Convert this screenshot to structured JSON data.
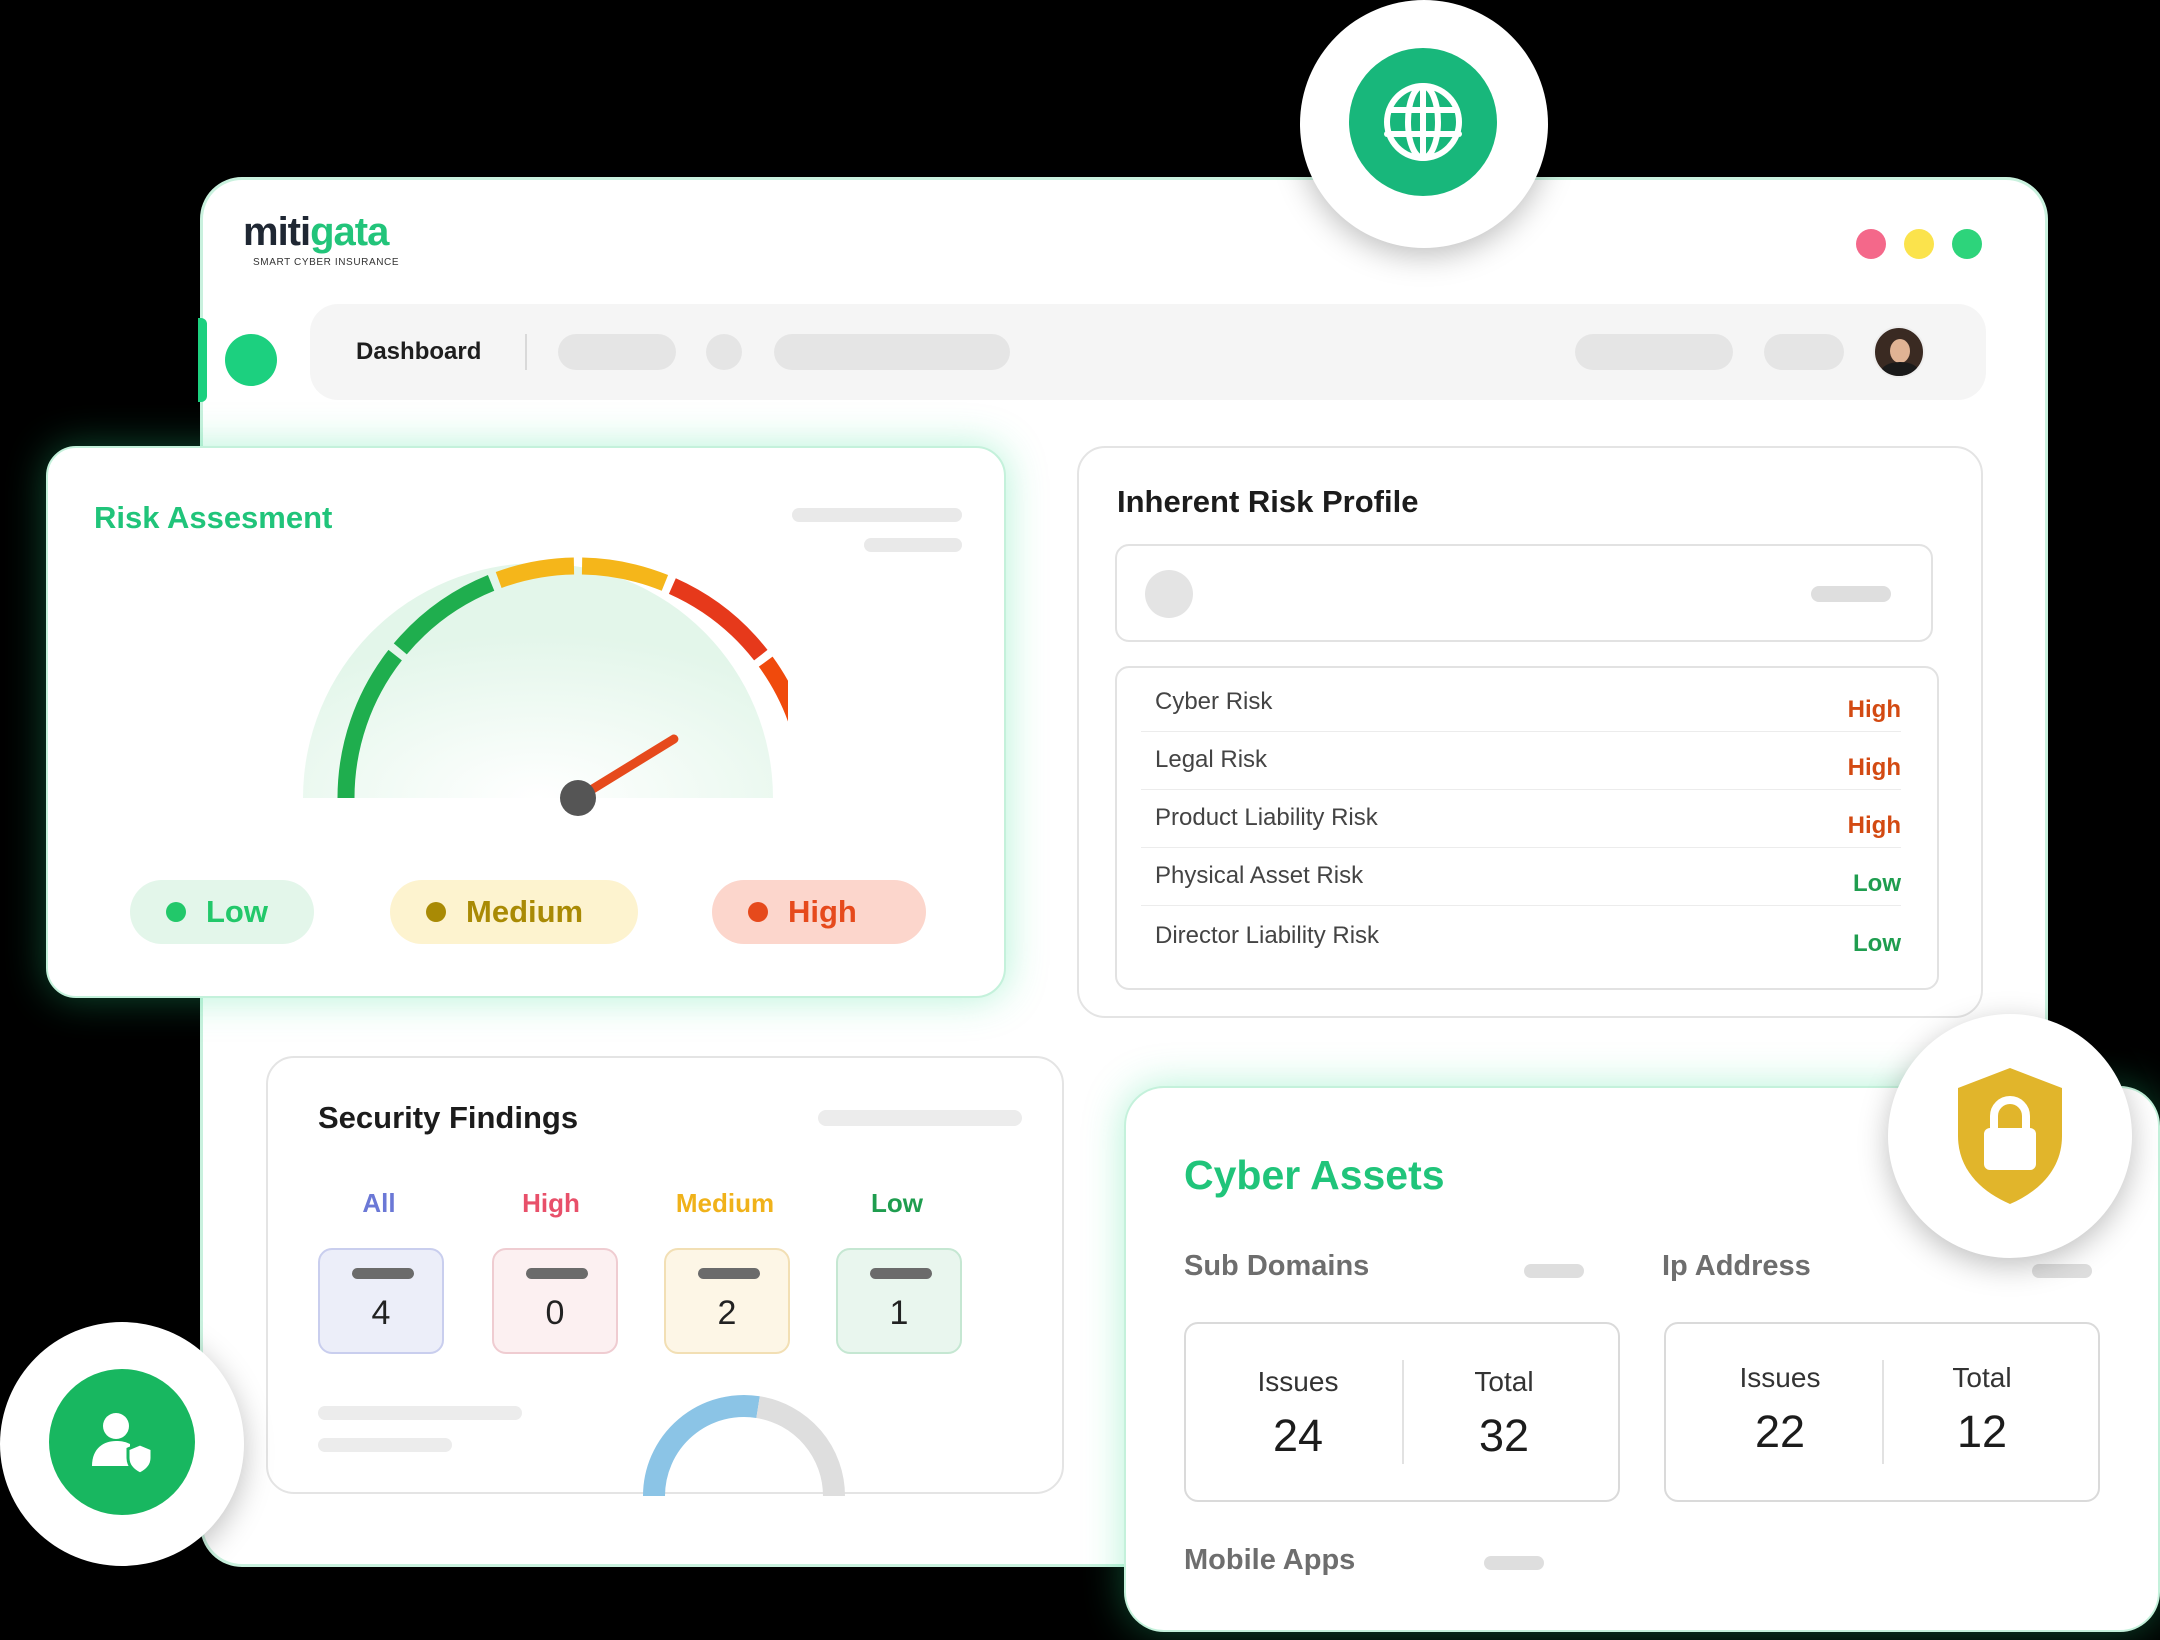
{
  "brand": {
    "name_part1": "miti",
    "name_part2": "gata",
    "tagline": "SMART CYBER INSURANCE"
  },
  "window_controls": [
    {
      "name": "close",
      "color": "#f4688a"
    },
    {
      "name": "minimize",
      "color": "#fbe34c"
    },
    {
      "name": "maximize",
      "color": "#2dd47b"
    }
  ],
  "navbar": {
    "title": "Dashboard"
  },
  "risk_assessment": {
    "title": "Risk Assesment",
    "gauge_level": 0.73,
    "legend": [
      {
        "label": "Low",
        "color": "#22c86a",
        "bg": "#e3f6ea"
      },
      {
        "label": "Medium",
        "color": "#a98a05",
        "bg": "#fdf3cf"
      },
      {
        "label": "High",
        "color": "#e64a1c",
        "bg": "#fcd6cc"
      }
    ]
  },
  "inherent_risk_profile": {
    "title": "Inherent Risk Profile",
    "rows": [
      {
        "label": "Cyber Risk",
        "value": "High",
        "color": "#d34a12"
      },
      {
        "label": "Legal Risk",
        "value": "High",
        "color": "#d34a12"
      },
      {
        "label": "Product Liability Risk",
        "value": "High",
        "color": "#d34a12"
      },
      {
        "label": "Physical Asset Risk",
        "value": "Low",
        "color": "#1f9d4f"
      },
      {
        "label": "Director Liability Risk",
        "value": "Low",
        "color": "#1f9d4f"
      }
    ]
  },
  "security_findings": {
    "title": "Security Findings",
    "tabs": [
      {
        "label": "All",
        "count": "4",
        "color": "#6b78d6",
        "bg": "#eceef9",
        "border": "#c9ceee"
      },
      {
        "label": "High",
        "count": "0",
        "color": "#e8506a",
        "bg": "#fcf0f1",
        "border": "#efccd1"
      },
      {
        "label": "Medium",
        "count": "2",
        "color": "#f0b21a",
        "bg": "#fdf6e6",
        "border": "#f2dfb4"
      },
      {
        "label": "Low",
        "count": "1",
        "color": "#1f9d4f",
        "bg": "#e9f6ee",
        "border": "#c5e7d2"
      }
    ],
    "donut_fraction": 0.55
  },
  "cyber_assets": {
    "title": "Cyber Assets",
    "sub_domains": {
      "label": "Sub Domains",
      "issues_label": "Issues",
      "issues": "24",
      "total_label": "Total",
      "total": "32"
    },
    "ip_address": {
      "label": "Ip Address",
      "issues_label": "Issues",
      "issues": "22",
      "total_label": "Total",
      "total": "12"
    },
    "mobile_apps": {
      "label": "Mobile Apps"
    }
  },
  "floating_icons": [
    "globe-icon",
    "lock-shield-icon",
    "user-shield-icon"
  ]
}
